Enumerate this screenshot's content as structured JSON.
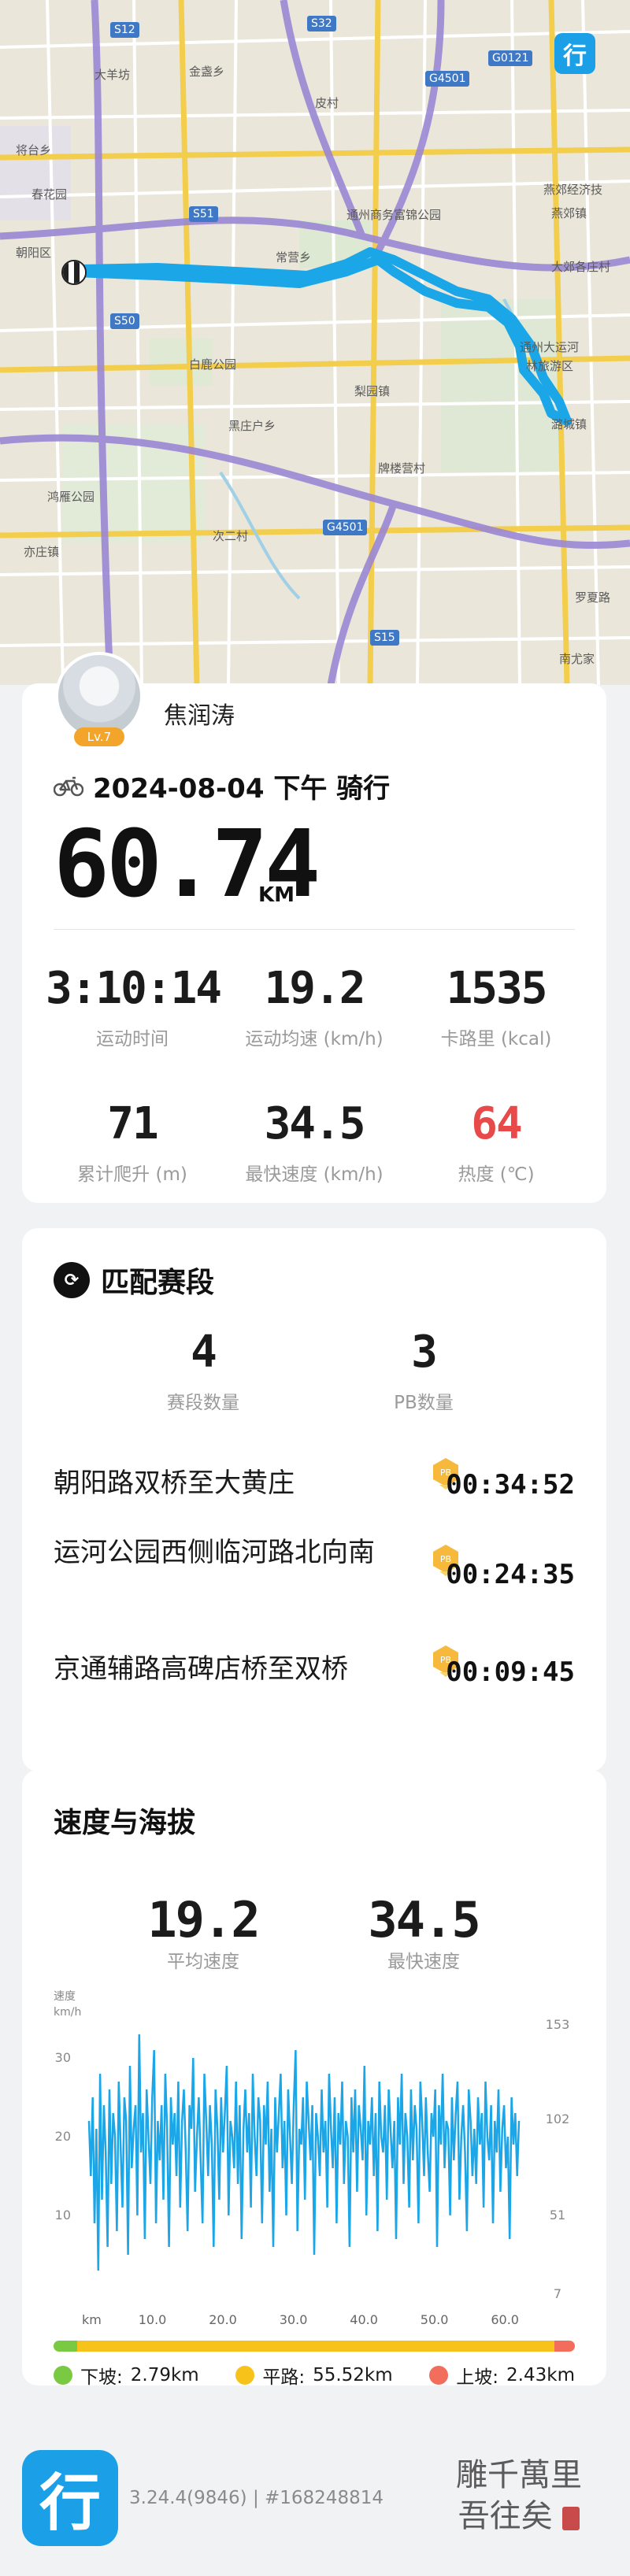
{
  "map": {
    "labels": [
      "大羊坊",
      "金盏乡",
      "皮村",
      "燕郊经济技",
      "燕郊镇",
      "将台乡",
      "春花园",
      "通州商务富锦公园",
      "大郊各庄村",
      "常营乡",
      "通州大运河",
      "林旅游区",
      "潞城镇",
      "白鹿公园",
      "梨园镇",
      "黑庄户乡",
      "牌楼营村",
      "次二村",
      "鸿雁公园",
      "亦庄镇",
      "朝阳区",
      "罗夏路",
      "南尤家"
    ],
    "shields": [
      "S12",
      "S32",
      "G4501",
      "G0121",
      "S51",
      "S50",
      "G4501",
      "S15"
    ],
    "app_badge": "行"
  },
  "profile": {
    "username": "焦润涛",
    "level": "Lv.7"
  },
  "ride": {
    "title": "2024-08-04 下午 骑行",
    "distance": "60.74",
    "distance_unit": "KM"
  },
  "stats": [
    {
      "value": "3:10:14",
      "label": "运动时间"
    },
    {
      "value": "19.2",
      "label": "运动均速 (km/h)"
    },
    {
      "value": "1535",
      "label": "卡路里 (kcal)"
    },
    {
      "value": "71",
      "label": "累计爬升 (m)"
    },
    {
      "value": "34.5",
      "label": "最快速度 (km/h)"
    },
    {
      "value": "64",
      "label": "热度 (℃)"
    }
  ],
  "segments": {
    "title": "匹配赛段",
    "count_value": "4",
    "count_label": "赛段数量",
    "pb_value": "3",
    "pb_label": "PB数量",
    "pb_badge": "PB",
    "items": [
      {
        "name": "朝阳路双桥至大黄庄",
        "time": "00:34:52"
      },
      {
        "name": "运河公园西侧临河路北向南",
        "time": "00:24:35"
      },
      {
        "name": "京通辅路高碑店桥至双桥",
        "time": "00:09:45"
      }
    ]
  },
  "speed": {
    "title": "速度与海拔",
    "avg_value": "19.2",
    "avg_label": "平均速度",
    "max_value": "34.5",
    "max_label": "最快速度",
    "legend": [
      {
        "label": "下坡:",
        "value": "2.79km",
        "color": "#7ac943"
      },
      {
        "label": "平路:",
        "value": "55.52km",
        "color": "#f7c31b"
      },
      {
        "label": "上坡:",
        "value": "2.43km",
        "color": "#f26d5b"
      }
    ]
  },
  "chart_data": {
    "type": "line",
    "left_axis_label": "速度",
    "left_axis_unit": "km/h",
    "x_unit": "km",
    "x_ticks": [
      "10.0",
      "20.0",
      "30.0",
      "40.0",
      "50.0",
      "60.0"
    ],
    "y_ticks": [
      "30",
      "20",
      "10"
    ],
    "y2_ticks": [
      "153",
      "102",
      "51",
      "7"
    ],
    "xlim": [
      0,
      63
    ],
    "ylim": [
      0,
      35
    ],
    "series": [
      {
        "values": [
          22,
          15,
          25,
          9,
          21,
          3,
          28,
          12,
          24,
          18,
          6,
          26,
          14,
          23,
          20,
          8,
          27,
          19,
          11,
          25,
          22,
          5,
          29,
          16,
          21,
          24,
          10,
          33,
          18,
          23,
          7,
          26,
          20,
          14,
          25,
          31,
          9,
          22,
          17,
          24,
          12,
          28,
          21,
          6,
          25,
          19,
          23,
          15,
          27,
          11,
          22,
          26,
          18,
          8,
          24,
          21,
          30,
          13,
          20,
          25,
          17,
          9,
          28,
          22,
          15,
          24,
          19,
          6,
          26,
          21,
          12,
          25,
          18,
          23,
          29,
          10,
          22,
          20,
          16,
          27,
          14,
          24,
          7,
          21,
          26,
          18,
          23,
          11,
          28,
          20,
          15,
          25,
          22,
          9,
          24,
          19,
          27,
          13,
          21,
          6,
          25,
          18,
          23,
          28,
          16,
          22,
          10,
          26,
          20,
          14,
          24,
          31,
          8,
          21,
          19,
          25,
          12,
          27,
          22,
          17,
          24,
          5,
          23,
          20,
          15,
          26,
          18,
          22,
          11,
          28,
          21,
          16,
          25,
          9,
          23,
          19,
          27,
          14,
          22,
          20,
          6,
          25,
          18,
          26,
          13,
          24,
          21,
          17,
          29,
          10,
          22,
          19,
          25,
          15,
          23,
          8,
          27,
          20,
          18,
          24,
          12,
          26,
          21,
          16,
          22,
          7,
          25,
          19,
          28,
          14,
          23,
          20,
          11,
          26,
          17,
          24,
          21,
          9,
          27,
          22,
          15,
          25,
          18,
          13,
          23,
          20,
          26,
          6,
          24,
          19,
          28,
          16,
          22,
          21,
          10,
          25,
          17,
          23,
          27,
          12,
          20,
          24,
          18,
          8,
          26,
          22,
          15,
          21,
          14,
          25,
          19,
          23,
          11,
          27,
          20,
          17,
          24,
          9,
          22,
          18,
          26,
          13,
          21,
          24,
          16,
          20,
          7,
          25,
          19,
          23,
          15,
          22
        ]
      }
    ]
  }
}
